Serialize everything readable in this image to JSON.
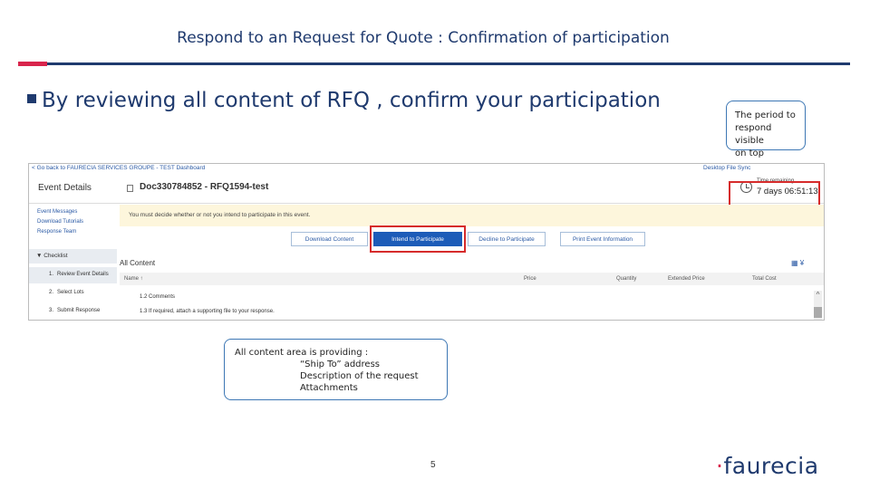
{
  "slide": {
    "title": "Respond to an Request for Quote : Confirmation of participation",
    "bullet": "By reviewing all content of RFQ , confirm your participation",
    "page_number": "5",
    "logo": {
      "dot": "·",
      "text": "faurecia"
    },
    "colors": {
      "brand_navy": "#1f3a6e",
      "accent_red": "#d9254c",
      "highlight_red": "#d62b2b",
      "callout_border": "#3d77b4"
    }
  },
  "callouts": {
    "period": {
      "line1": "The period to",
      "line2": "respond visible",
      "line3": "on top"
    },
    "content": {
      "line1": "All content area is providing :",
      "line2": "“Ship To” address",
      "line3": "Description of the request",
      "line4": "Attachments"
    }
  },
  "screenshot": {
    "back_link": "< Go back to FAURECIA SERVICES GROUPE - TEST Dashboard",
    "file_sync": "Desktop File Sync",
    "event_details_title": "Event Details",
    "doc_title": "Doc330784852 - RFQ1594-test",
    "time_label": "Time remaining",
    "time_value": "7 days 06:51:13",
    "nav": {
      "event_messages": "Event Messages",
      "download_tutorials": "Download Tutorials",
      "response_team": "Response Team",
      "checklist": "▼ Checklist",
      "steps": [
        {
          "num": "1.",
          "label": "Review Event Details"
        },
        {
          "num": "2.",
          "label": "Select Lots"
        },
        {
          "num": "3.",
          "label": "Submit Response"
        }
      ]
    },
    "notice": "You must decide whether or not you intend to participate in this event.",
    "buttons": {
      "download": "Download Content",
      "intend": "Intend to Participate",
      "decline": "Decline to Participate",
      "print": "Print Event Information"
    },
    "all_content": "All Content",
    "table_icons": "▦ ¥",
    "columns": {
      "name": "Name ↑",
      "price": "Price",
      "quantity": "Quantity",
      "extended_price": "Extended Price",
      "total_cost": "Total Cost"
    },
    "rows": [
      {
        "label": "1.2  Comments"
      },
      {
        "label": "1.3  If required, attach a supporting file to your response."
      }
    ],
    "scroll_up": "^"
  }
}
